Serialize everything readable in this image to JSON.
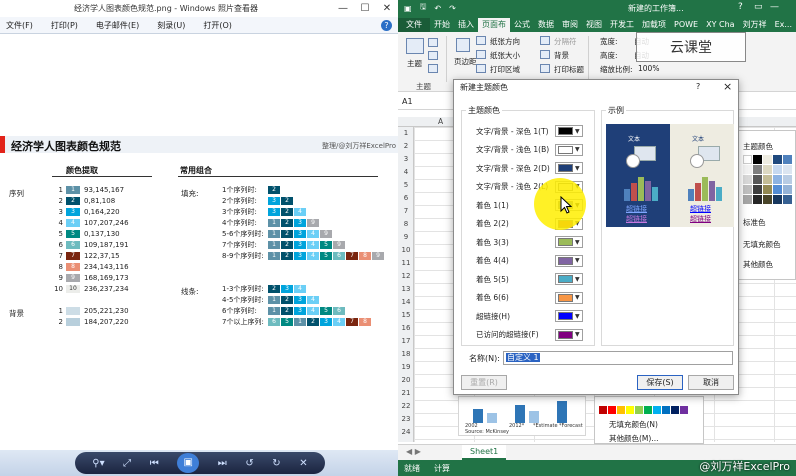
{
  "viewer": {
    "title": "经济学人图表颜色规范.png - Windows 照片查看器",
    "menu": [
      "文件(F)",
      "打印(P)",
      "电子邮件(E)",
      "刻录(U)",
      "打开(O)"
    ],
    "help": "?",
    "image": {
      "title": "经济学人图表颜色规范",
      "credit": "整理/@刘万祥ExcelPro",
      "sec1_heading": "颜色提取",
      "sec2_heading": "常用组合",
      "series_label": "序列",
      "background_label": "背景",
      "fill_label": "填充:",
      "line_label": "线条:",
      "series_colors": [
        {
          "n": "1",
          "rgb": "93,145,167",
          "color": "#5d91a7"
        },
        {
          "n": "2",
          "rgb": "0,81,108",
          "color": "#00516c"
        },
        {
          "n": "3",
          "rgb": "0,164,220",
          "color": "#00a4dc"
        },
        {
          "n": "4",
          "rgb": "107,207,246",
          "color": "#6bcff6"
        },
        {
          "n": "5",
          "rgb": "0,137,130",
          "color": "#008982"
        },
        {
          "n": "6",
          "rgb": "109,187,191",
          "color": "#6dbbbf"
        },
        {
          "n": "7",
          "rgb": "122,37,15",
          "color": "#7a250f"
        },
        {
          "n": "8",
          "rgb": "234,143,116",
          "color": "#ea8f74"
        },
        {
          "n": "9",
          "rgb": "168,169,173",
          "color": "#a8a9ad"
        },
        {
          "n": "10",
          "rgb": "236,237,234",
          "color": "#ecedea"
        }
      ],
      "background_colors": [
        {
          "n": "1",
          "rgb": "205,221,230",
          "color": "#cddde6"
        },
        {
          "n": "2",
          "rgb": "184,207,220",
          "color": "#b8cfdc"
        }
      ],
      "fill_combos": [
        {
          "label": "1个序列时:",
          "idx": [
            2
          ]
        },
        {
          "label": "2个序列时:",
          "idx": [
            3,
            2
          ]
        },
        {
          "label": "3个序列时:",
          "idx": [
            3,
            2,
            4
          ]
        },
        {
          "label": "4个序列时:",
          "idx": [
            1,
            2,
            3,
            9
          ]
        },
        {
          "label": "5-6个序列时:",
          "idx": [
            1,
            2,
            3,
            4,
            9
          ]
        },
        {
          "label": "7个序列时:",
          "idx": [
            1,
            2,
            3,
            4,
            5,
            9
          ]
        },
        {
          "label": "8-9个序列时:",
          "idx": [
            1,
            2,
            3,
            4,
            5,
            6,
            7,
            8,
            9
          ]
        }
      ],
      "line_combos": [
        {
          "label": "1-3个序列时:",
          "idx": [
            2,
            3,
            4
          ]
        },
        {
          "label": "4-5个序列时:",
          "idx": [
            1,
            2,
            3,
            4
          ]
        },
        {
          "label": "6个序列时:",
          "idx": [
            1,
            2,
            3,
            4,
            5,
            6
          ]
        },
        {
          "label": "7个以上序列:",
          "idx": [
            6,
            5,
            1,
            2,
            3,
            4,
            7,
            8
          ]
        }
      ]
    }
  },
  "excel": {
    "doc_title": "新建的工作簿...",
    "tabs": [
      "文件",
      "开始",
      "插入",
      "页面布",
      "公式",
      "数据",
      "审阅",
      "视图",
      "开发工",
      "加载项",
      "POWE",
      "XY Cha",
      "刘万祥",
      "Ex..."
    ],
    "active_tab": "页面布",
    "ribbon": {
      "theme_label": "主题",
      "margins": "页边距",
      "orientation": "纸张方向",
      "size": "纸张大小",
      "print_area": "打印区域",
      "breaks": "分隔符",
      "background": "背景",
      "print_titles": "打印标题",
      "width_label": "宽度:",
      "width_val": "自动",
      "height_label": "高度:",
      "height_val": "自动",
      "scale_label": "缩放比例:",
      "scale_val": "100%",
      "group_theme": "主题"
    },
    "namebox": "A1",
    "col_a": "A",
    "row_numbers": [
      "1",
      "2",
      "3",
      "4",
      "5",
      "6",
      "7",
      "8",
      "9",
      "10",
      "11",
      "12",
      "13",
      "14",
      "15",
      "16",
      "17",
      "18",
      "19",
      "20",
      "21",
      "22",
      "23",
      "24"
    ],
    "sheet_tab": "Sheet1",
    "status": [
      "就绪",
      "计算"
    ],
    "panel": {
      "theme_colors": "主题颜色",
      "std_colors": "标准色",
      "no_fill": "无填充颜色",
      "more_colors": "其他颜色"
    },
    "lowpanel": {
      "no_fill": "无填充颜色(N)",
      "more": "其他颜色(M)..."
    },
    "lowchart": {
      "years": [
        "2002",
        "2012*",
        "*Estimate",
        "*Forecast"
      ],
      "source": "Source: McKinsey"
    }
  },
  "dialog": {
    "title": "新建主题颜色",
    "help": "?",
    "close": "×",
    "theme_colors_label": "主题颜色",
    "sample_label": "示例",
    "rows": [
      {
        "label": "文字/背景 - 深色 1(T)",
        "color": "#000000"
      },
      {
        "label": "文字/背景 - 浅色 1(B)",
        "color": "#ffffff"
      },
      {
        "label": "文字/背景 - 深色 2(D)",
        "color": "#1f3f78"
      },
      {
        "label": "文字/背景 - 浅色 2(L)",
        "color": "#eeece1"
      },
      {
        "label": "着色 1(1)",
        "color": "#4f81bd"
      },
      {
        "label": "着色 2(2)",
        "color": "#c0504d"
      },
      {
        "label": "着色 3(3)",
        "color": "#9bbb59"
      },
      {
        "label": "着色 4(4)",
        "color": "#8064a2"
      },
      {
        "label": "着色 5(5)",
        "color": "#4bacc6"
      },
      {
        "label": "着色 6(6)",
        "color": "#f79646"
      },
      {
        "label": "超链接(H)",
        "color": "#0000ff"
      },
      {
        "label": "已访问的超链接(F)",
        "color": "#800080"
      }
    ],
    "sample_text": "文本",
    "sample_link": "超链接",
    "name_label": "名称(N):",
    "name_value": "自定义 1",
    "reset_label": "重置(R)",
    "save_label": "保存(S)",
    "cancel_label": "取消"
  },
  "watermark": "云课堂",
  "watermark2": "@刘万祥ExcelPro"
}
